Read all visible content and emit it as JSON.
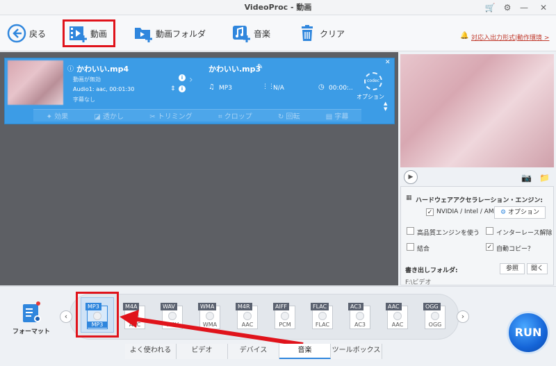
{
  "app": {
    "title": "VideoProc - 動画"
  },
  "toolbar": {
    "back_label": "戻る",
    "video_label": "動画",
    "video_folder_label": "動画フォルダ",
    "music_label": "音楽",
    "clear_label": "クリア",
    "notice_label": "対応入出力形式|動作環境 >"
  },
  "file": {
    "source_name": "かわいい.mp4",
    "output_name": "かわいい.mp3",
    "video_status": "動画が無効",
    "audio_info": "Audio1: aac, 00:01:30",
    "subtitle_status": "字幕なし",
    "output_format": "MP3",
    "resolution": "N/A",
    "duration": "00:00:..",
    "option_label": "オプション",
    "codec_label": "codec"
  },
  "card_tools": [
    {
      "label": "効果",
      "icon": "magic-wand-icon"
    },
    {
      "label": "透かし",
      "icon": "watermark-icon"
    },
    {
      "label": "トリミング",
      "icon": "scissors-icon"
    },
    {
      "label": "クロップ",
      "icon": "crop-icon"
    },
    {
      "label": "回転",
      "icon": "rotate-icon"
    },
    {
      "label": "字幕",
      "icon": "subtitle-icon"
    }
  ],
  "settings": {
    "hw_title": "ハードウェアアクセラレーション・エンジン:",
    "hw_option": "NVIDIA / Intel / AMD",
    "hw_checked": true,
    "option_button": "オプション",
    "high_quality": "高品質エンジンを使う",
    "high_quality_checked": false,
    "deinterlace": "インターレース解除",
    "deinterlace_checked": false,
    "merge": "結合",
    "merge_checked": false,
    "auto_copy": "自動コピー？",
    "auto_copy_checked": true,
    "output_folder_label": "書き出しフォルダ:",
    "browse_button": "参照",
    "open_button": "開く",
    "output_path": "F:\\ビデオ"
  },
  "format_panel": {
    "label": "フォーマット",
    "formats": [
      {
        "tag": "MP3",
        "sub": "MP3",
        "selected": true
      },
      {
        "tag": "M4A",
        "sub": "AAC",
        "selected": false
      },
      {
        "tag": "WAV",
        "sub": "WAV",
        "selected": false
      },
      {
        "tag": "WMA",
        "sub": "WMA",
        "selected": false
      },
      {
        "tag": "M4R",
        "sub": "AAC",
        "selected": false
      },
      {
        "tag": "AIFF",
        "sub": "PCM",
        "selected": false
      },
      {
        "tag": "FLAC",
        "sub": "FLAC",
        "selected": false
      },
      {
        "tag": "AC3",
        "sub": "AC3",
        "selected": false
      },
      {
        "tag": "AAC",
        "sub": "AAC",
        "selected": false
      },
      {
        "tag": "OGG",
        "sub": "OGG",
        "selected": false
      }
    ]
  },
  "tabs": [
    {
      "label": "よく使われる",
      "active": false
    },
    {
      "label": "ビデオ",
      "active": false
    },
    {
      "label": "デバイス",
      "active": false
    },
    {
      "label": "音楽",
      "active": true
    },
    {
      "label": "ツールボックス",
      "active": false
    }
  ],
  "run_label": "RUN",
  "colors": {
    "accent": "#2f86dd",
    "card": "#3c9ce6",
    "highlight": "#e0131b"
  }
}
